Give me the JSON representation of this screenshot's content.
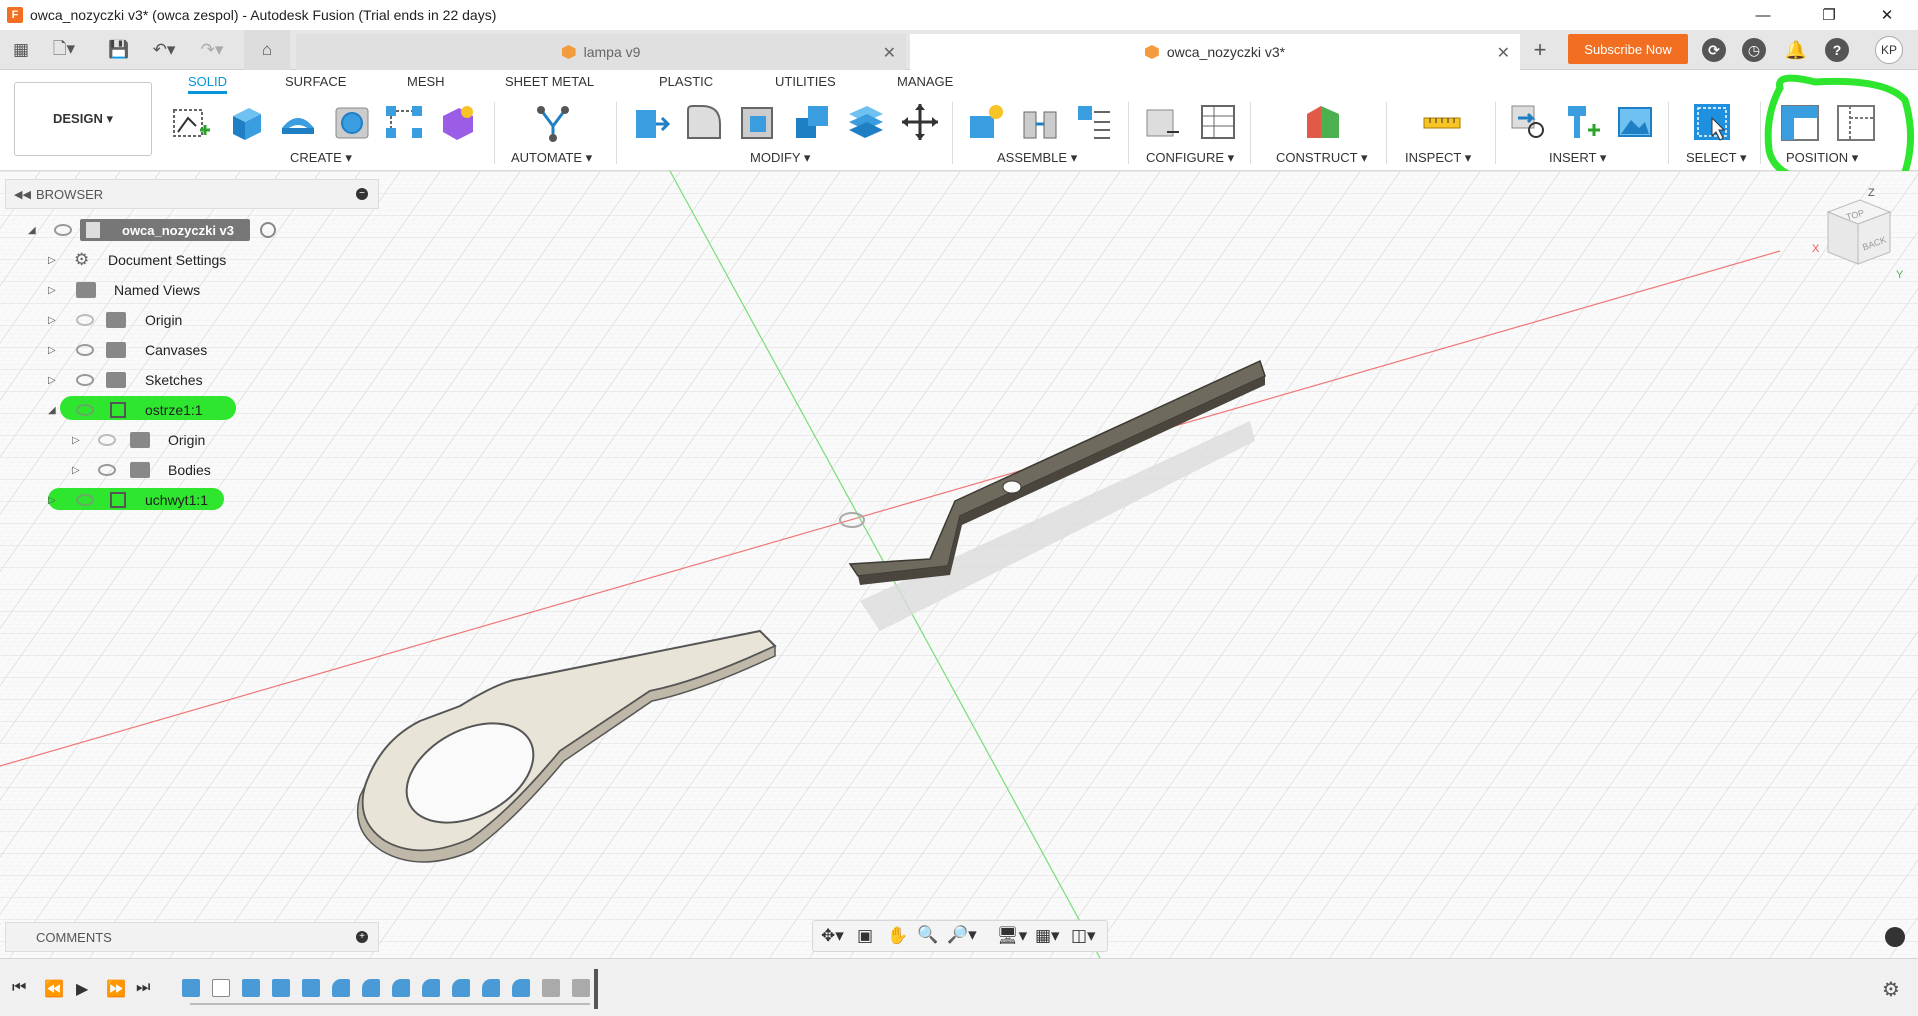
{
  "titlebar": {
    "icon_letter": "F",
    "title": "owca_nozyczki v3* (owca zespol) - Autodesk Fusion (Trial ends in 22 days)"
  },
  "tabs": [
    {
      "label": "lampa v9",
      "active": false
    },
    {
      "label": "owca_nozyczki v3*",
      "active": true
    }
  ],
  "subscribe_label": "Subscribe Now",
  "avatar_initials": "KP",
  "workspace_label": "DESIGN ▾",
  "ribbon_tabs": [
    "SOLID",
    "SURFACE",
    "MESH",
    "SHEET METAL",
    "PLASTIC",
    "UTILITIES",
    "MANAGE"
  ],
  "ribbon_groups": [
    "CREATE ▾",
    "AUTOMATE ▾",
    "MODIFY ▾",
    "ASSEMBLE ▾",
    "CONFIGURE ▾",
    "CONSTRUCT ▾",
    "INSPECT ▾",
    "INSERT ▾",
    "SELECT ▾",
    "POSITION ▾"
  ],
  "browser": {
    "title": "BROWSER",
    "root": "owca_nozyczki v3",
    "items": [
      "Document Settings",
      "Named Views",
      "Origin",
      "Canvases",
      "Sketches",
      "ostrze1:1",
      "Origin",
      "Bodies",
      "uchwyt1:1"
    ]
  },
  "comments_label": "COMMENTS",
  "viewcube": {
    "top": "TOP",
    "back": "BACK",
    "axis_x": "X",
    "axis_z": "Z",
    "axis_y": "Y"
  },
  "colors": {
    "accent": "#0696d7",
    "subscribe": "#f26f21",
    "highlight": "#2ee62e",
    "blade": "#6e6a5e",
    "handle": "#e9e4d8"
  }
}
